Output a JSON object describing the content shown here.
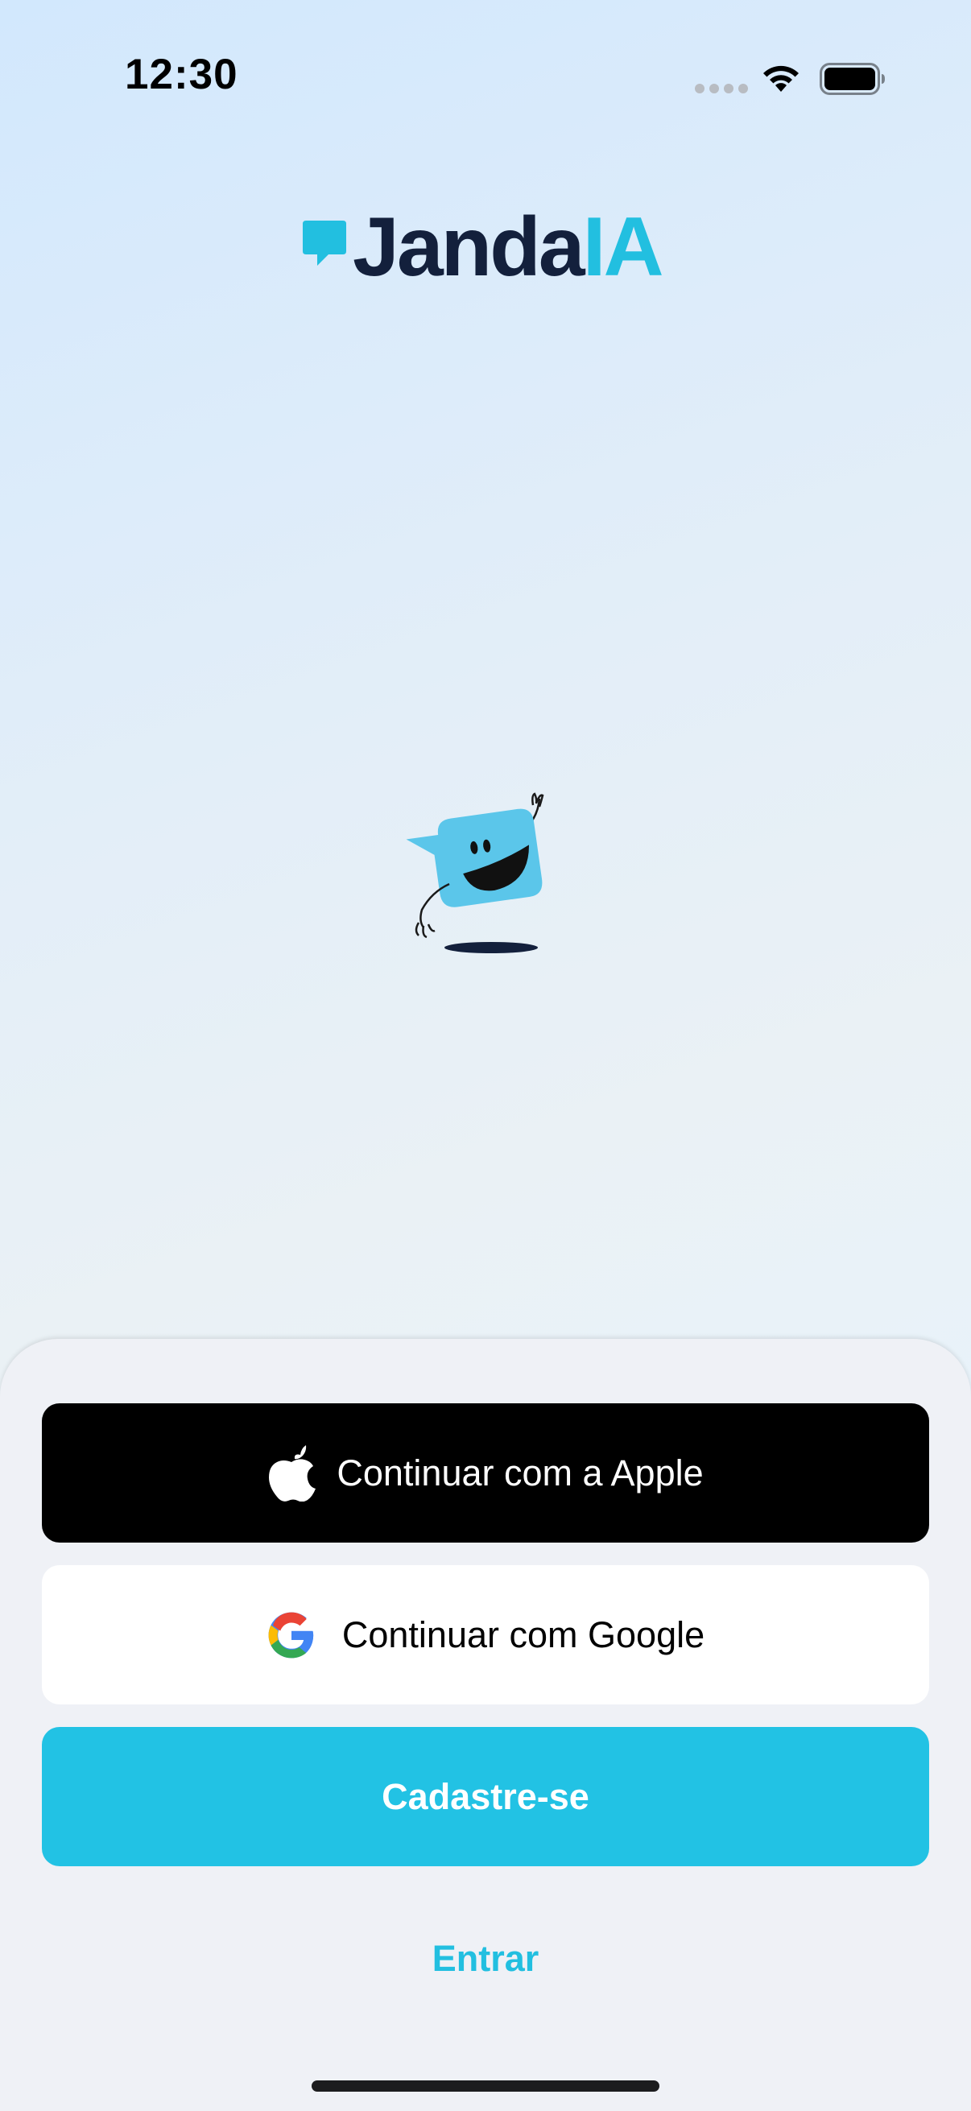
{
  "status_bar": {
    "time": "12:30",
    "signal_icon": "cellular-signal-icon",
    "wifi_icon": "wifi-icon",
    "battery_icon": "battery-icon"
  },
  "brand": {
    "logo_dark_text": "Janda",
    "logo_accent_text": "IA",
    "logo_icon": "speech-bubble-icon",
    "mascot": "waving-speech-bubble-mascot",
    "colors": {
      "dark": "#13203c",
      "accent": "#22bfe0"
    }
  },
  "auth": {
    "apple_label": "Continuar com a Apple",
    "apple_icon": "apple-logo-icon",
    "google_label": "Continuar com Google",
    "google_icon": "google-logo-icon",
    "signup_label": "Cadastre-se",
    "login_label": "Entrar",
    "colors": {
      "apple_bg": "#000000",
      "google_bg": "#ffffff",
      "signup_bg": "#22c2e4",
      "login_text": "#22bfe0"
    }
  }
}
